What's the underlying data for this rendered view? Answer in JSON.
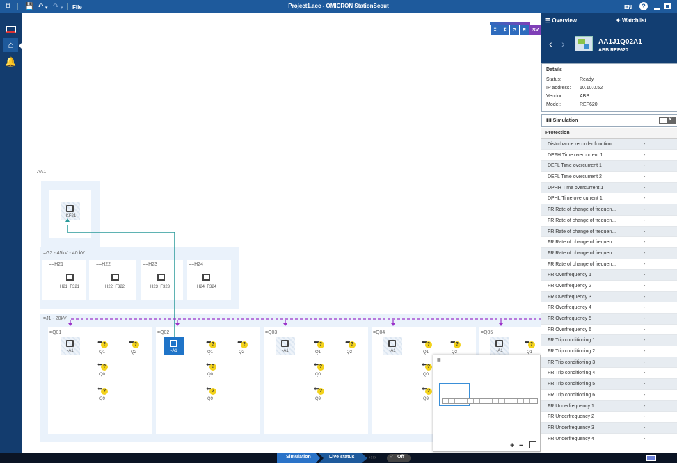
{
  "app": {
    "title": "Project1.acc - OMICRON StationScout",
    "file_menu": "File",
    "language": "EN"
  },
  "canvas": {
    "toolbar_buttons": [
      "G",
      "R",
      "SV"
    ],
    "substation_label": "AA1",
    "top_device": "-KF21",
    "zone_g2": {
      "label": "=G2 - 45kV - 40 kV",
      "bays": [
        {
          "title": "==H21",
          "device": "H21_F321_"
        },
        {
          "title": "==H22",
          "device": "H22_F322_"
        },
        {
          "title": "==H23",
          "device": "H23_F323_"
        },
        {
          "title": "==H24",
          "device": "H24_F324_"
        }
      ]
    },
    "zone_j1": {
      "label": "=J1 - 20kV",
      "bays": [
        "=Q01",
        "=Q02",
        "=Q03",
        "=Q04",
        "=Q05"
      ],
      "device_label": "-A1",
      "switch_labels": [
        "Q1",
        "Q2",
        "Q0",
        "Q9"
      ],
      "question_mark": "?"
    },
    "minimap": {
      "zoom_in": "+",
      "zoom_out": "−"
    }
  },
  "panel": {
    "tab_overview": "Overview",
    "tab_watchlist": "Watchlist",
    "device_name": "AA1J1Q02A1",
    "device_model_sub": "ABB REF620",
    "details_title": "Details",
    "details": [
      {
        "key": "Status:",
        "value": "Ready"
      },
      {
        "key": "IP address:",
        "value": "10.10.0.52"
      },
      {
        "key": "Vendor:",
        "value": "ABB"
      },
      {
        "key": "Model:",
        "value": "REF620"
      }
    ],
    "simulation_label": "Simulation",
    "protection_title": "Protection",
    "protection_items": [
      {
        "name": "Disturbance recorder function",
        "value": "-"
      },
      {
        "name": "DEFH Time overcurrent 1",
        "value": "-"
      },
      {
        "name": "DEFL Time overcurrent 1",
        "value": "-"
      },
      {
        "name": "DEFL Time overcurrent 2",
        "value": "-"
      },
      {
        "name": "DPHH Time overcurrent 1",
        "value": "-"
      },
      {
        "name": "DPHL Time overcurrent 1",
        "value": "-"
      },
      {
        "name": "FR Rate of change of frequen...",
        "value": "-"
      },
      {
        "name": "FR Rate of change of frequen...",
        "value": "-"
      },
      {
        "name": "FR Rate of change of frequen...",
        "value": "-"
      },
      {
        "name": "FR Rate of change of frequen...",
        "value": "-"
      },
      {
        "name": "FR Rate of change of frequen...",
        "value": "-"
      },
      {
        "name": "FR Rate of change of frequen...",
        "value": "-"
      },
      {
        "name": "FR Overfrequency 1",
        "value": "-"
      },
      {
        "name": "FR Overfrequency 2",
        "value": "-"
      },
      {
        "name": "FR Overfrequency 3",
        "value": "-"
      },
      {
        "name": "FR Overfrequency 4",
        "value": "-"
      },
      {
        "name": "FR Overfrequency 5",
        "value": "-"
      },
      {
        "name": "FR Overfrequency 6",
        "value": "-"
      },
      {
        "name": "FR Trip conditioning 1",
        "value": "-"
      },
      {
        "name": "FR Trip conditioning 2",
        "value": "-"
      },
      {
        "name": "FR Trip conditioning 3",
        "value": "-"
      },
      {
        "name": "FR Trip conditioning 4",
        "value": "-"
      },
      {
        "name": "FR Trip conditioning 5",
        "value": "-"
      },
      {
        "name": "FR Trip conditioning 6",
        "value": "-"
      },
      {
        "name": "FR Underfrequency 1",
        "value": "-"
      },
      {
        "name": "FR Underfrequency 2",
        "value": "-"
      },
      {
        "name": "FR Underfrequency 3",
        "value": "-"
      },
      {
        "name": "FR Underfrequency 4",
        "value": "-"
      }
    ]
  },
  "statusbar": {
    "simulation": "Simulation",
    "live_status": "Live status",
    "off": "Off"
  },
  "colors": {
    "titlebar": "#1e5a9c",
    "sidebar": "#133c6e",
    "selected_device": "#1f74c8",
    "bus_line": "#9b32c9",
    "link_line": "#2a9a9a"
  },
  "icons": [
    "app-logo-icon",
    "save-icon",
    "undo-icon",
    "redo-icon",
    "help-icon",
    "minimize-icon",
    "maximize-icon",
    "list-icon",
    "pin-icon",
    "back-icon",
    "forward-icon",
    "device-icon",
    "switch-icon",
    "question-icon"
  ]
}
